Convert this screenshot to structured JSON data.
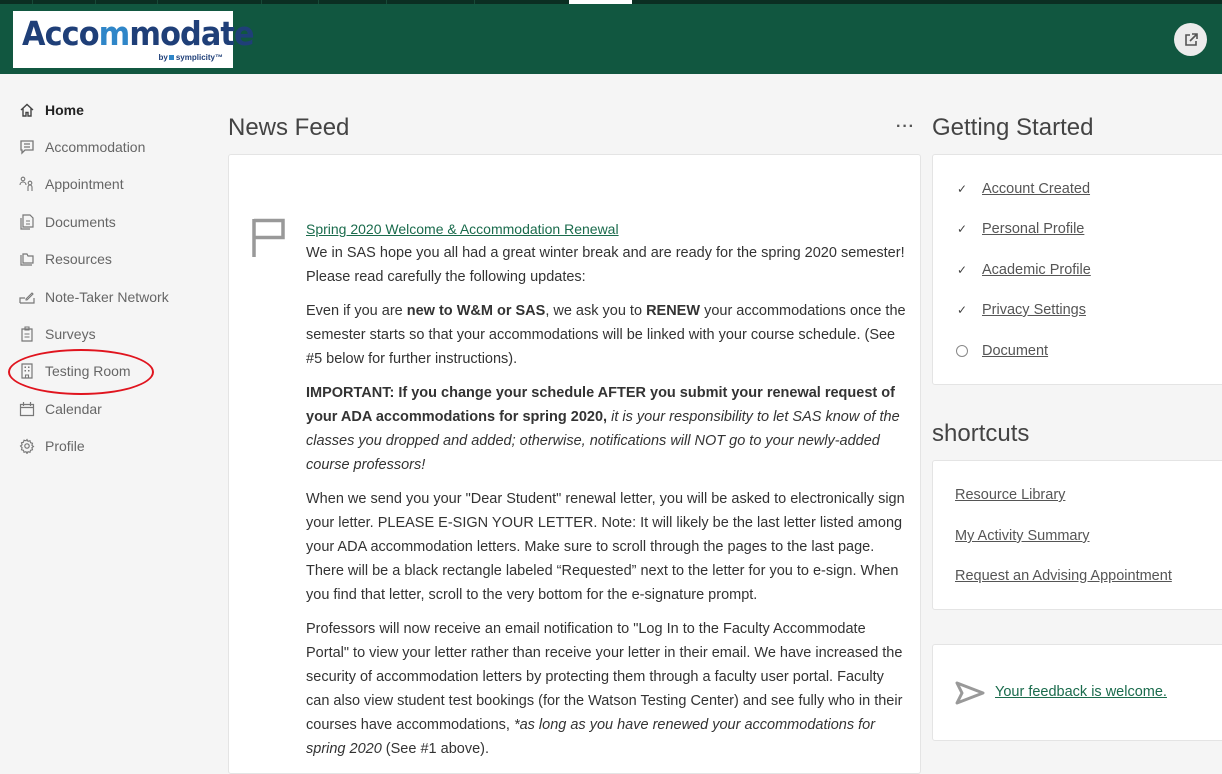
{
  "header": {
    "logo_text_pre": "Acco",
    "logo_text_m": "m",
    "logo_text_post": "modate",
    "logo_by": "by",
    "logo_brand": "symplicity™",
    "external_link_icon": "external-link-icon"
  },
  "sidebar": {
    "items": [
      {
        "label": "Home",
        "icon": "home-icon",
        "active": true
      },
      {
        "label": "Accommodation",
        "icon": "message-list-icon"
      },
      {
        "label": "Appointment",
        "icon": "people-icon"
      },
      {
        "label": "Documents",
        "icon": "documents-icon"
      },
      {
        "label": "Resources",
        "icon": "folders-icon"
      },
      {
        "label": "Note-Taker Network",
        "icon": "signature-icon"
      },
      {
        "label": "Surveys",
        "icon": "clipboard-icon"
      },
      {
        "label": "Testing Room",
        "icon": "building-icon",
        "highlighted": true
      },
      {
        "label": "Calendar",
        "icon": "calendar-icon"
      },
      {
        "label": "Profile",
        "icon": "gear-icon"
      }
    ]
  },
  "news_feed": {
    "title": "News Feed",
    "more_label": "···",
    "post": {
      "title": "Spring 2020 Welcome & Accommodation Renewal",
      "p1": "We in SAS hope you all had a great winter break and are ready for the spring 2020 semester! Please read carefully the following updates:",
      "p2_a": "Even if you are ",
      "p2_b": "new to W&M or SAS",
      "p2_c": ", we ask you to ",
      "p2_d": "RENEW",
      "p2_e": " your accommodations once the semester starts so that your accommodations will be linked with your course schedule. (See #5 below for further instructions).",
      "p3_bold": "IMPORTANT: If you change your schedule AFTER you submit your renewal request of your ADA accommodations for spring 2020,",
      "p3_italic": " it is your responsibility to let SAS know of the classes you dropped and added; otherwise, notifications will NOT go to your newly-added course professors!",
      "p4": "When we send you your \"Dear Student\" renewal letter, you will be asked to electronically sign your letter. PLEASE E-SIGN YOUR LETTER. Note: It will likely be the last letter listed among your ADA accommodation letters. Make sure to scroll through the pages to the last page. There will be a black rectangle labeled “Requested” next to the letter for you to e-sign. When you find that letter, scroll to the very bottom for the e-signature prompt.",
      "p5_a": "Professors will now receive an email notification to \"Log In to the Faculty Accommodate Portal\" to view your letter rather than receive your letter in their email. We have increased the security of accommodation letters by protecting them through a faculty user portal. Faculty can also view student test bookings (for the Watson Testing Center) and see fully who in their courses have accommodations, ",
      "p5_italic": "*as long as you have renewed your accommodations for spring 2020",
      "p5_c": " (See #1 above)."
    }
  },
  "getting_started": {
    "title": "Getting Started",
    "items": [
      {
        "label": "Account Created",
        "status": "done"
      },
      {
        "label": "Personal Profile",
        "status": "done"
      },
      {
        "label": "Academic Profile",
        "status": "done"
      },
      {
        "label": "Privacy Settings",
        "status": "done"
      },
      {
        "label": "Document",
        "status": "pending"
      }
    ],
    "check_glyph": "✓"
  },
  "shortcuts": {
    "title": "shortcuts",
    "items": [
      {
        "label": "Resource Library"
      },
      {
        "label": "My Activity Summary"
      },
      {
        "label": "Request an Advising Appointment"
      }
    ]
  },
  "feedback": {
    "label": "Your feedback is welcome.",
    "icon": "send-icon"
  },
  "colors": {
    "brand_green": "#115740",
    "link_green": "#1a6b4c",
    "highlight_red": "#e0141e"
  }
}
